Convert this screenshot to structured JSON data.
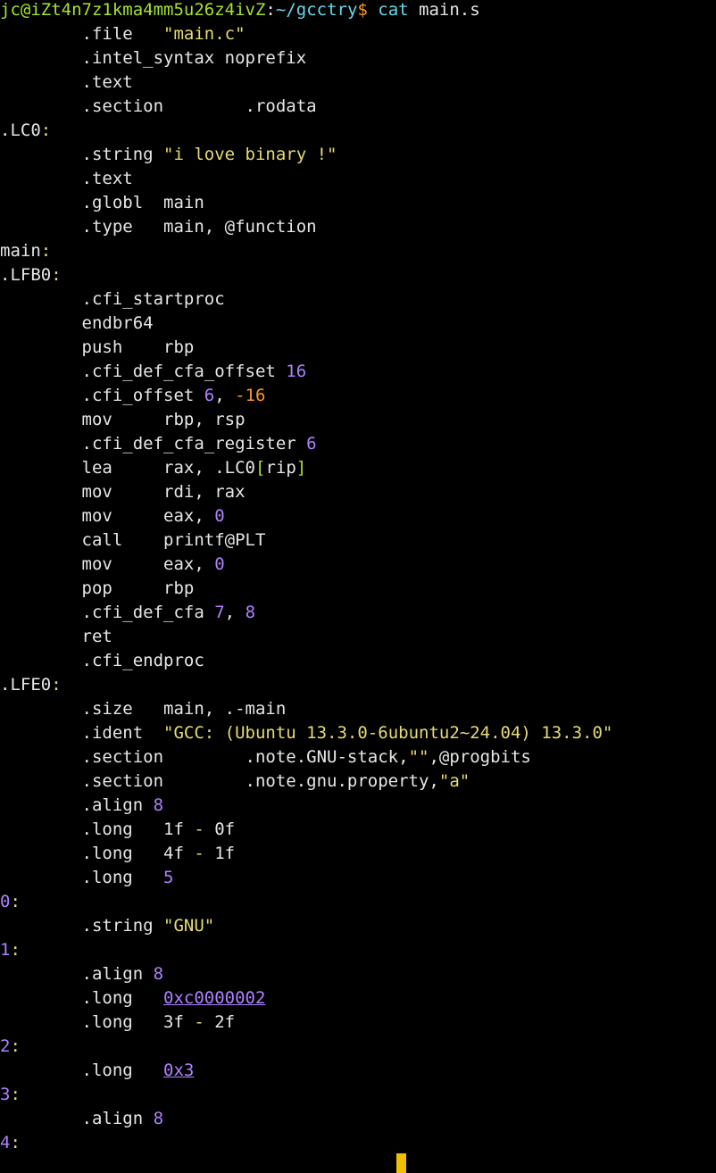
{
  "colors": {
    "background": "#000000",
    "text": "#e6e6e6",
    "prompt_user": "#a6e22e",
    "prompt_path": "#66d9ef",
    "dollar": "#fd971f",
    "string": "#e6db74",
    "number": "#ae81ff",
    "negative": "#fd971f",
    "cursor": "#f0c000"
  },
  "lines": [
    {
      "segs": [
        {
          "t": "jc@iZt4n7z1kma4mm5u26z4ivZ",
          "c": "g"
        },
        {
          "t": ":",
          "c": "w"
        },
        {
          "t": "~/gcctry",
          "c": "b"
        },
        {
          "t": "$ ",
          "c": "o"
        },
        {
          "t": "cat",
          "c": "b"
        },
        {
          "t": " main.s",
          "c": "w"
        }
      ]
    },
    {
      "segs": [
        {
          "t": "        .file   ",
          "c": "w"
        },
        {
          "t": "\"main.c\"",
          "c": "y"
        }
      ]
    },
    {
      "segs": [
        {
          "t": "        .intel_syntax noprefix",
          "c": "w"
        }
      ]
    },
    {
      "segs": [
        {
          "t": "        .text",
          "c": "w"
        }
      ]
    },
    {
      "segs": [
        {
          "t": "        .section        .rodata",
          "c": "w"
        }
      ]
    },
    {
      "segs": [
        {
          "t": ".LC0",
          "c": "w"
        },
        {
          "t": ":",
          "c": "y"
        }
      ]
    },
    {
      "segs": [
        {
          "t": "        .string ",
          "c": "w"
        },
        {
          "t": "\"i love binary !\"",
          "c": "y"
        }
      ]
    },
    {
      "segs": [
        {
          "t": "        .text",
          "c": "w"
        }
      ]
    },
    {
      "segs": [
        {
          "t": "        .globl  main",
          "c": "w"
        }
      ]
    },
    {
      "segs": [
        {
          "t": "        .type   main, @function",
          "c": "w"
        }
      ]
    },
    {
      "segs": [
        {
          "t": "main",
          "c": "w"
        },
        {
          "t": ":",
          "c": "y"
        }
      ]
    },
    {
      "segs": [
        {
          "t": ".LFB0",
          "c": "w"
        },
        {
          "t": ":",
          "c": "y"
        }
      ]
    },
    {
      "segs": [
        {
          "t": "        .cfi_startproc",
          "c": "w"
        }
      ]
    },
    {
      "segs": [
        {
          "t": "        endbr64",
          "c": "w"
        }
      ]
    },
    {
      "segs": [
        {
          "t": "        push    rbp",
          "c": "w"
        }
      ]
    },
    {
      "segs": [
        {
          "t": "        .cfi_def_cfa_offset ",
          "c": "w"
        },
        {
          "t": "16",
          "c": "p"
        }
      ]
    },
    {
      "segs": [
        {
          "t": "        .cfi_offset ",
          "c": "w"
        },
        {
          "t": "6",
          "c": "p"
        },
        {
          "t": ", ",
          "c": "w"
        },
        {
          "t": "-16",
          "c": "o"
        }
      ]
    },
    {
      "segs": [
        {
          "t": "        mov     rbp, rsp",
          "c": "w"
        }
      ]
    },
    {
      "segs": [
        {
          "t": "        .cfi_def_cfa_register ",
          "c": "w"
        },
        {
          "t": "6",
          "c": "p"
        }
      ]
    },
    {
      "segs": [
        {
          "t": "        lea     rax, .LC0",
          "c": "w"
        },
        {
          "t": "[",
          "c": "g"
        },
        {
          "t": "rip",
          "c": "w"
        },
        {
          "t": "]",
          "c": "g"
        }
      ]
    },
    {
      "segs": [
        {
          "t": "        mov     rdi, rax",
          "c": "w"
        }
      ]
    },
    {
      "segs": [
        {
          "t": "        mov     eax, ",
          "c": "w"
        },
        {
          "t": "0",
          "c": "p"
        }
      ]
    },
    {
      "segs": [
        {
          "t": "        call    printf@PLT",
          "c": "w"
        }
      ]
    },
    {
      "segs": [
        {
          "t": "        mov     eax, ",
          "c": "w"
        },
        {
          "t": "0",
          "c": "p"
        }
      ]
    },
    {
      "segs": [
        {
          "t": "        pop     rbp",
          "c": "w"
        }
      ]
    },
    {
      "segs": [
        {
          "t": "        .cfi_def_cfa ",
          "c": "w"
        },
        {
          "t": "7",
          "c": "p"
        },
        {
          "t": ", ",
          "c": "w"
        },
        {
          "t": "8",
          "c": "p"
        }
      ]
    },
    {
      "segs": [
        {
          "t": "        ret",
          "c": "w"
        }
      ]
    },
    {
      "segs": [
        {
          "t": "        .cfi_endproc",
          "c": "w"
        }
      ]
    },
    {
      "segs": [
        {
          "t": ".LFE0",
          "c": "w"
        },
        {
          "t": ":",
          "c": "y"
        }
      ]
    },
    {
      "segs": [
        {
          "t": "        .size   main, .-main",
          "c": "w"
        }
      ]
    },
    {
      "segs": [
        {
          "t": "        .ident  ",
          "c": "w"
        },
        {
          "t": "\"GCC: (Ubuntu 13.3.0-6ubuntu2~24.04) 13.3.0\"",
          "c": "y"
        }
      ]
    },
    {
      "segs": [
        {
          "t": "        .section        .note.GNU-stack,",
          "c": "w"
        },
        {
          "t": "\"\"",
          "c": "y"
        },
        {
          "t": ",@progbits",
          "c": "w"
        }
      ]
    },
    {
      "segs": [
        {
          "t": "        .section        .note.gnu.property,",
          "c": "w"
        },
        {
          "t": "\"a\"",
          "c": "y"
        }
      ]
    },
    {
      "segs": [
        {
          "t": "        .align ",
          "c": "w"
        },
        {
          "t": "8",
          "c": "p"
        }
      ]
    },
    {
      "segs": [
        {
          "t": "        .long   1f ",
          "c": "w"
        },
        {
          "t": "-",
          "c": "y"
        },
        {
          "t": " 0f",
          "c": "w"
        }
      ]
    },
    {
      "segs": [
        {
          "t": "        .long   4f ",
          "c": "w"
        },
        {
          "t": "-",
          "c": "y"
        },
        {
          "t": " 1f",
          "c": "w"
        }
      ]
    },
    {
      "segs": [
        {
          "t": "        .long   ",
          "c": "w"
        },
        {
          "t": "5",
          "c": "p"
        }
      ]
    },
    {
      "segs": [
        {
          "t": "0",
          "c": "p"
        },
        {
          "t": ":",
          "c": "y"
        }
      ]
    },
    {
      "segs": [
        {
          "t": "        .string ",
          "c": "w"
        },
        {
          "t": "\"GNU\"",
          "c": "y"
        }
      ]
    },
    {
      "segs": [
        {
          "t": "1",
          "c": "p"
        },
        {
          "t": ":",
          "c": "y"
        }
      ]
    },
    {
      "segs": [
        {
          "t": "        .align ",
          "c": "w"
        },
        {
          "t": "8",
          "c": "p"
        }
      ]
    },
    {
      "segs": [
        {
          "t": "        .long   ",
          "c": "w"
        },
        {
          "t": "0xc0000002",
          "c": "p u"
        }
      ]
    },
    {
      "segs": [
        {
          "t": "        .long   3f ",
          "c": "w"
        },
        {
          "t": "-",
          "c": "y"
        },
        {
          "t": " 2f",
          "c": "w"
        }
      ]
    },
    {
      "segs": [
        {
          "t": "2",
          "c": "p"
        },
        {
          "t": ":",
          "c": "y"
        }
      ]
    },
    {
      "segs": [
        {
          "t": "        .long   ",
          "c": "w"
        },
        {
          "t": "0x3",
          "c": "p u"
        }
      ]
    },
    {
      "segs": [
        {
          "t": "3",
          "c": "p"
        },
        {
          "t": ":",
          "c": "y"
        }
      ]
    },
    {
      "segs": [
        {
          "t": "        .align ",
          "c": "w"
        },
        {
          "t": "8",
          "c": "p"
        }
      ]
    },
    {
      "segs": [
        {
          "t": "4",
          "c": "p"
        },
        {
          "t": ":",
          "c": "y"
        }
      ]
    }
  ]
}
